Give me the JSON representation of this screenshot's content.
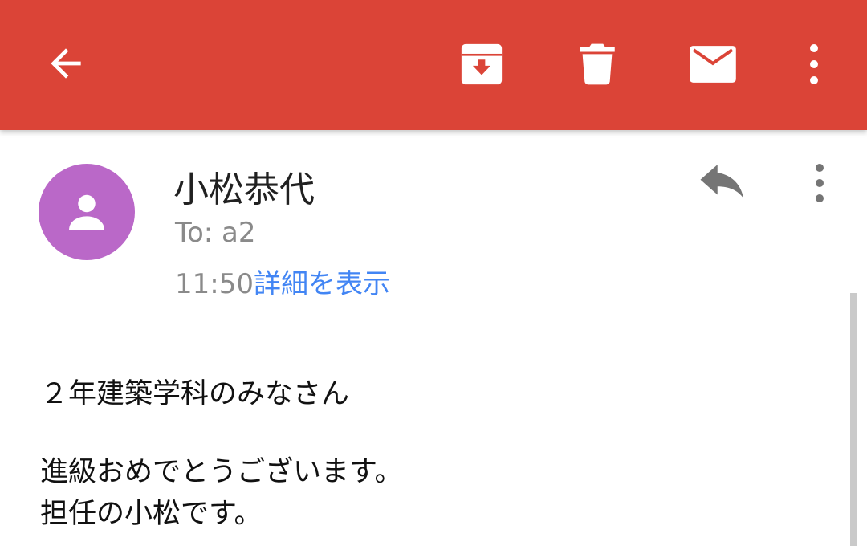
{
  "colors": {
    "appbar": "#db4437",
    "avatar": "#ba68c8",
    "link": "#4285f4",
    "secondary_text": "#8a8a8a",
    "primary_text": "#212121"
  },
  "toolbar": {
    "icons": [
      "arrow-back-icon",
      "archive-icon",
      "delete-icon",
      "mark-unread-icon",
      "more-vert-icon"
    ]
  },
  "message": {
    "sender_name": "小松恭代",
    "to_line": "To: a2",
    "time": "11:50",
    "details_link": "詳細を表示",
    "icons": [
      "person-icon",
      "reply-icon",
      "more-vert-icon"
    ],
    "body": {
      "greeting": "２年建築学科のみなさん",
      "lines": [
        "進級おめでとうございます。",
        "担任の小松です。"
      ]
    }
  }
}
